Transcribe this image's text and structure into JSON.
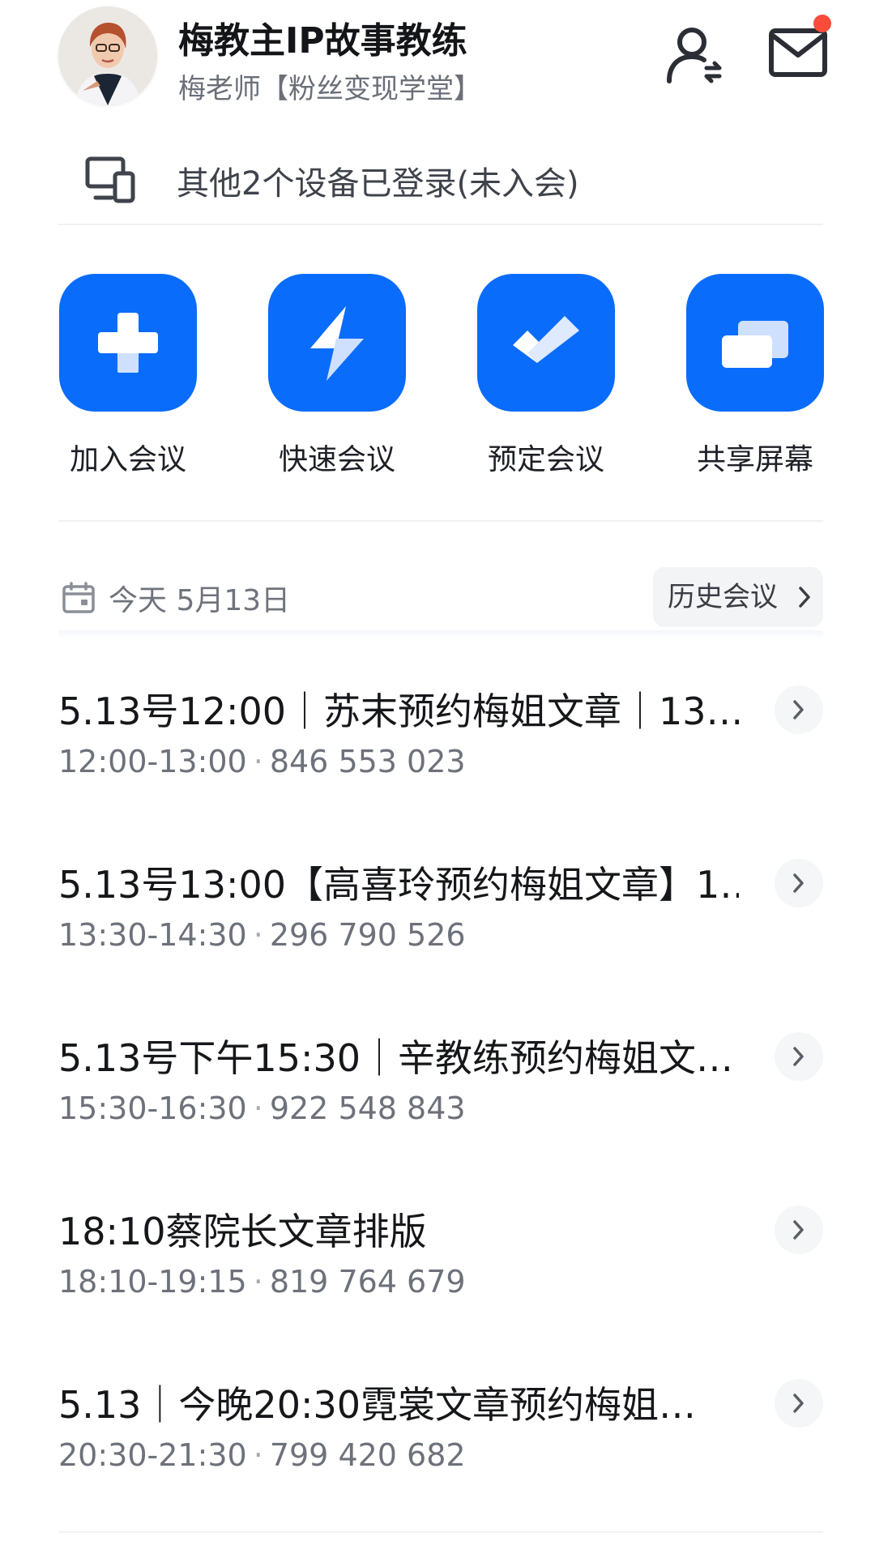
{
  "header": {
    "name": "梅教主IP故事教练",
    "subtitle": "梅老师【粉丝变现学堂】",
    "contact_icon": "contacts-icon",
    "mail_icon": "mail-icon",
    "notification_color": "#fa4b3b"
  },
  "devices": {
    "text": "其他2个设备已登录(未入会)",
    "icon": "devices-icon"
  },
  "actions": [
    {
      "label": "加入会议",
      "icon": "plus-icon"
    },
    {
      "label": "快速会议",
      "icon": "lightning-icon"
    },
    {
      "label": "预定会议",
      "icon": "checkmark-icon"
    },
    {
      "label": "共享屏幕",
      "icon": "share-screen-icon"
    }
  ],
  "accent_color": "#0a6cfb",
  "datebar": {
    "date": "今天 5月13日",
    "history_label": "历史会议"
  },
  "meetings": [
    {
      "title": "5.13号12:00｜苏末预约梅姐文章｜13…",
      "time": "12:00-13:00",
      "id": "846 553 023"
    },
    {
      "title": "5.13号13:00【高喜玲预约梅姐文章】1…",
      "time": "13:30-14:30",
      "id": "296 790 526"
    },
    {
      "title": "5.13号下午15:30｜辛教练预约梅姐文…",
      "time": "15:30-16:30",
      "id": "922 548 843"
    },
    {
      "title": "18:10蔡院长文章排版",
      "time": "18:10-19:15",
      "id": "819 764 679"
    },
    {
      "title": "5.13｜今晚20:30霓裳文章预约梅姐…",
      "time": "20:30-21:30",
      "id": "799 420 682"
    }
  ]
}
